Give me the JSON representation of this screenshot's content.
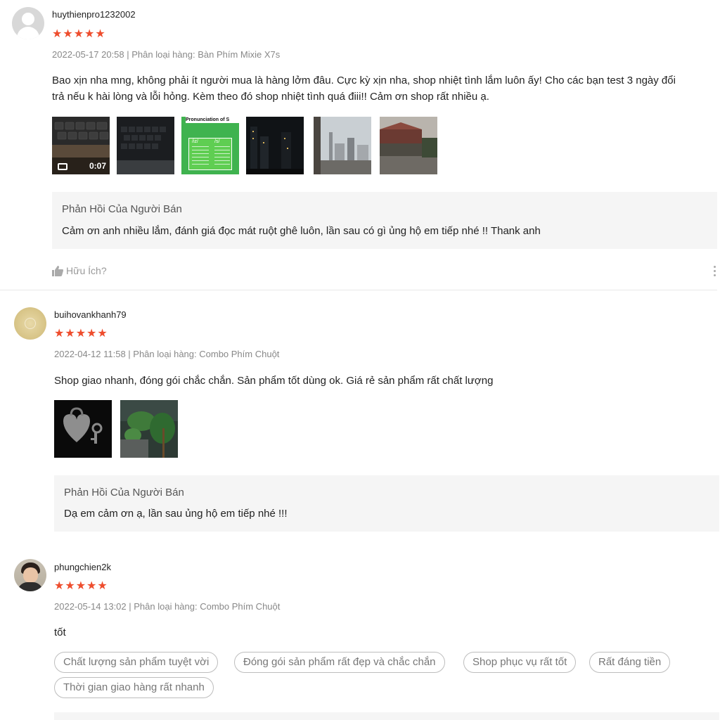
{
  "reviews": [
    {
      "username": "huythienpro1232002",
      "stars": "★★★★★",
      "meta": "2022-05-17 20:58 | Phân loại hàng: Bàn Phím Mixie X7s",
      "comment_line1": "Bao xịn nha mng, không phải ít người mua là hàng lởm đâu. Cực kỳ xịn nha, shop nhiệt tình lắm luôn ấy! Cho các bạn test 3 ngày đổi",
      "comment_line2": "trả nếu k hài lòng và lỗi hỏng. Kèm theo đó shop nhiệt tình quá điii!! Cảm ơn shop rất nhiều ạ.",
      "video_duration": "0:07",
      "thumb3_title": "Pronunciation of S",
      "thumb3_col1": "/iz/",
      "thumb3_col2": "/s/",
      "reply_title": "Phản Hồi Của Người Bán",
      "reply_text": "Cảm ơn anh nhiều lắm, đánh giá đọc mát ruột ghê luôn, lần sau có gì ủng hộ em tiếp nhé !! Thank anh",
      "helpful_label": "Hữu Ích?"
    },
    {
      "username": "buihovankhanh79",
      "stars": "★★★★★",
      "meta": "2022-04-12 11:58 | Phân loại hàng: Combo Phím Chuột",
      "comment": "Shop giao nhanh, đóng gói chắc chắn. Sản phẩm tốt dùng ok. Giá rẻ sản phẩm rất chất lượng",
      "reply_title": "Phản Hồi Của Người Bán",
      "reply_text": "Dạ em cảm ơn ạ, lần sau ủng hộ em tiếp nhé !!!"
    },
    {
      "username": "phungchien2k",
      "stars": "★★★★★",
      "meta": "2022-05-14 13:02 | Phân loại hàng: Combo Phím Chuột",
      "comment": "tốt",
      "tags": [
        "Chất lượng sản phẩm tuyệt vời",
        "Đóng gói sản phẩm rất đẹp và chắc chắn",
        "Shop phục vụ rất tốt",
        "Rất đáng tiền",
        "Thời gian giao hàng rất nhanh"
      ]
    }
  ],
  "icons": {
    "play": "video-camera-icon",
    "helpful": "thumbs-up-icon",
    "more": "more-vertical-icon"
  },
  "colors": {
    "star": "#ee4d2d",
    "reply_bg": "#f5f5f5",
    "meta": "#888888"
  }
}
